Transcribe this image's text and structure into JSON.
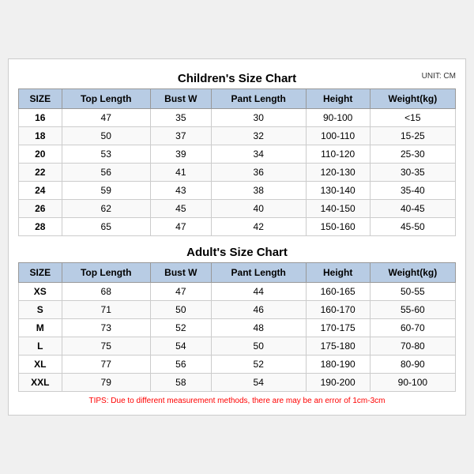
{
  "children_title": "Children's Size Chart",
  "adult_title": "Adult's Size Chart",
  "unit": "UNIT: CM",
  "children_headers": [
    "SIZE",
    "Top Length",
    "Bust W",
    "Pant Length",
    "Height",
    "Weight(kg)"
  ],
  "children_rows": [
    [
      "16",
      "47",
      "35",
      "30",
      "90-100",
      "<15"
    ],
    [
      "18",
      "50",
      "37",
      "32",
      "100-110",
      "15-25"
    ],
    [
      "20",
      "53",
      "39",
      "34",
      "110-120",
      "25-30"
    ],
    [
      "22",
      "56",
      "41",
      "36",
      "120-130",
      "30-35"
    ],
    [
      "24",
      "59",
      "43",
      "38",
      "130-140",
      "35-40"
    ],
    [
      "26",
      "62",
      "45",
      "40",
      "140-150",
      "40-45"
    ],
    [
      "28",
      "65",
      "47",
      "42",
      "150-160",
      "45-50"
    ]
  ],
  "adult_headers": [
    "SIZE",
    "Top Length",
    "Bust W",
    "Pant Length",
    "Height",
    "Weight(kg)"
  ],
  "adult_rows": [
    [
      "XS",
      "68",
      "47",
      "44",
      "160-165",
      "50-55"
    ],
    [
      "S",
      "71",
      "50",
      "46",
      "160-170",
      "55-60"
    ],
    [
      "M",
      "73",
      "52",
      "48",
      "170-175",
      "60-70"
    ],
    [
      "L",
      "75",
      "54",
      "50",
      "175-180",
      "70-80"
    ],
    [
      "XL",
      "77",
      "56",
      "52",
      "180-190",
      "80-90"
    ],
    [
      "XXL",
      "79",
      "58",
      "54",
      "190-200",
      "90-100"
    ]
  ],
  "tips": "TIPS: Due to different measurement methods, there are may be an error of 1cm-3cm"
}
